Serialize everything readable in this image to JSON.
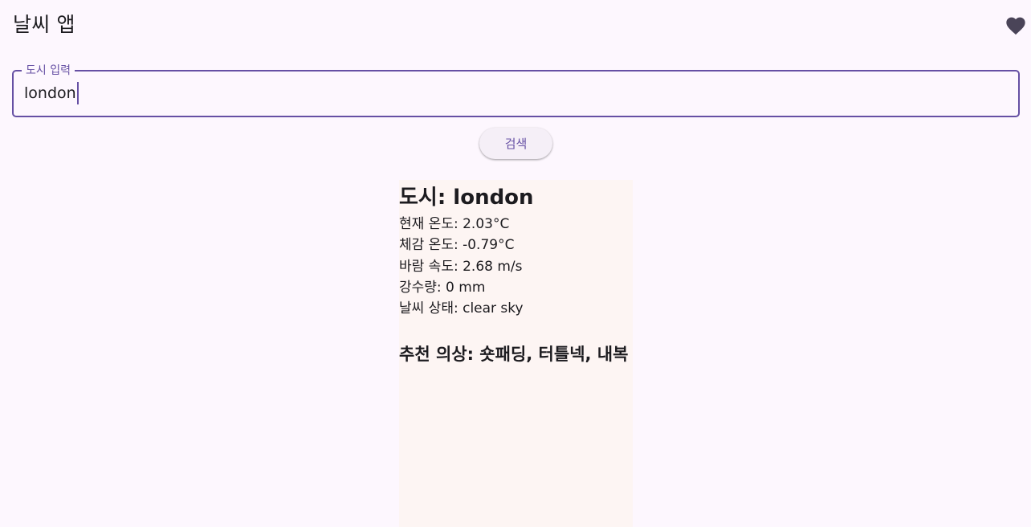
{
  "app": {
    "title": "날씨 앱",
    "favorite_icon": "heart-icon"
  },
  "search": {
    "label": "도시 입력",
    "value": "london",
    "button_label": "검색"
  },
  "weather": {
    "city": "도시: london",
    "current_temp": "현재 온도: 2.03°C",
    "feels_like": "체감 온도: -0.79°C",
    "wind_speed": "바람 속도: 2.68 m/s",
    "precipitation": "강수량: 0 mm",
    "condition": "날씨 상태: clear sky",
    "recommendation": "추천 의상: 숏패딩, 터틀넥, 내복"
  },
  "colors": {
    "accent": "#6650a4",
    "background": "#fdf7fe",
    "card_background": "#fdf5f3"
  }
}
